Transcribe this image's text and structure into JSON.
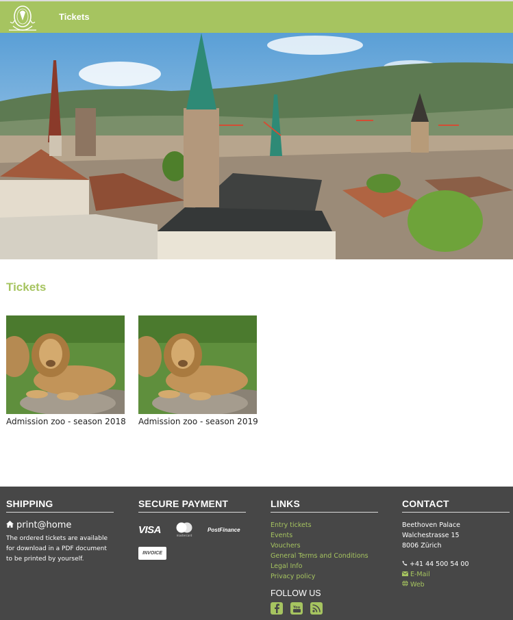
{
  "header": {
    "nav_tickets": "Tickets",
    "brand_color": "#a6c460"
  },
  "main": {
    "title": "Tickets",
    "products": [
      {
        "label": "Admission zoo - season 2018"
      },
      {
        "label": "Admission zoo - season 2019"
      }
    ]
  },
  "footer": {
    "shipping": {
      "heading": "SHIPPING",
      "method": "print@home",
      "description": "The ordered tickets are available for download in a PDF document to be printed by yourself."
    },
    "payment": {
      "heading": "SECURE PAYMENT",
      "visa": "VISA",
      "mastercard": "mastercard",
      "postfinance": "PostFinance",
      "invoice": "INVOICE"
    },
    "links": {
      "heading": "LINKS",
      "items": [
        "Entry tickets",
        "Events",
        "Vouchers",
        "General Terms and Conditions",
        "Legal Info",
        "Privacy policy"
      ],
      "follow_us": "FOLLOW US"
    },
    "contact": {
      "heading": "CONTACT",
      "name": "Beethoven Palace",
      "street": "Walchestrasse 15",
      "city": "8006 Zürich",
      "phone": "+41 44 500 54 00",
      "email": "E-Mail",
      "web": "Web"
    },
    "background_color": "#474747"
  }
}
